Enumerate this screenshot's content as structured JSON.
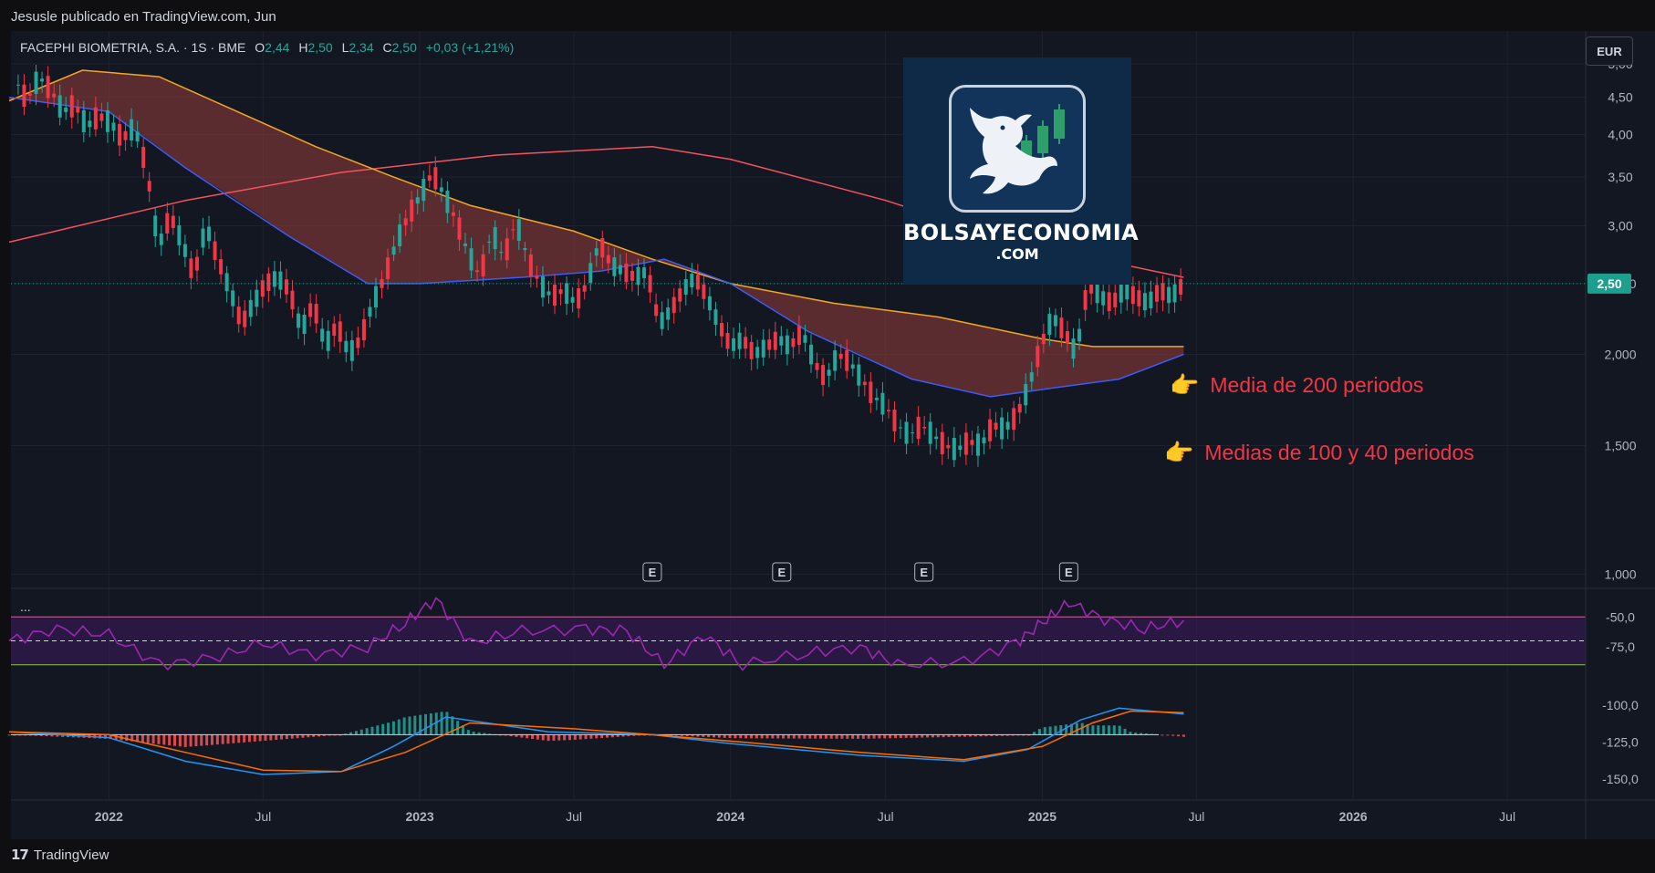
{
  "header": {
    "published": "Jesusle publicado en TradingView.com, Jun"
  },
  "footer": {
    "brand": "TradingView",
    "brand_icon": "tradingview-logo-icon"
  },
  "legend": {
    "symbol": "FACEPHI BIOMETRIA, S.A. · 1S · BME",
    "o_label": "O",
    "o": "2,44",
    "h_label": "H",
    "h": "2,50",
    "l_label": "L",
    "l": "2,34",
    "c_label": "C",
    "c": "2,50",
    "change": "+0,03 (+1,21%)"
  },
  "currency": "EUR",
  "logo": {
    "title": "BOLSAYECONOMIA",
    "subtitle": ".COM",
    "icon": "bull-candlestick-icon"
  },
  "annotations": {
    "ma200": "Media de 200 periodos",
    "ma100_40": "Medias de 100 y 40 periodos",
    "pointer_icon": "pointing-hand-icon"
  },
  "indicator_menu": "...",
  "earnings_marker": "E",
  "colors": {
    "up": "#26a69a",
    "down": "#f23645",
    "ma200": "#f7525f",
    "ma100": "#f5a623",
    "ma40": "#3d5cf5",
    "ribbon": "#8a3a3a",
    "rsi": "#9c27b0",
    "rsi_band": "#3a1a5c",
    "macd": "#2196f3",
    "signal": "#ff6d00",
    "price_badge": "#1e9e8c"
  },
  "chart_data": {
    "type": "candlestick",
    "title": "",
    "x_ticks": [
      "2022",
      "Jul",
      "2023",
      "Jul",
      "2024",
      "Jul",
      "2025",
      "Jul",
      "2026",
      "Jul"
    ],
    "x_tick_dates": [
      "2022-01-01",
      "2022-07-01",
      "2023-01-01",
      "2023-07-01",
      "2024-01-01",
      "2024-07-01",
      "2025-01-01",
      "2025-07-01",
      "2026-01-01",
      "2026-07-01"
    ],
    "y_ticks": [
      "5,00",
      "4,50",
      "4,00",
      "3,50",
      "3,00",
      "2,500",
      "2,000",
      "1,500",
      "1,000"
    ],
    "y_tick_values": [
      5.0,
      4.5,
      4.0,
      3.5,
      3.0,
      2.5,
      2.0,
      1.5,
      1.0
    ],
    "y_scale": "log",
    "ylim": [
      0.97,
      5.45
    ],
    "xlim": [
      "2021-09-08",
      "2026-10-01"
    ],
    "last_price": "2,50",
    "last_price_value": 2.5,
    "price_points": [
      [
        "2021-09-13",
        4.75
      ],
      [
        "2021-09-27",
        4.45
      ],
      [
        "2021-10-11",
        4.8
      ],
      [
        "2021-10-25",
        4.6
      ],
      [
        "2021-11-08",
        4.3
      ],
      [
        "2021-11-22",
        4.4
      ],
      [
        "2021-12-06",
        4.1
      ],
      [
        "2021-12-20",
        4.25
      ],
      [
        "2022-01-03",
        4.15
      ],
      [
        "2022-01-17",
        3.95
      ],
      [
        "2022-01-31",
        4.1
      ],
      [
        "2022-02-14",
        3.6
      ],
      [
        "2022-02-28",
        2.8
      ],
      [
        "2022-03-14",
        3.1
      ],
      [
        "2022-03-28",
        2.85
      ],
      [
        "2022-04-11",
        2.55
      ],
      [
        "2022-04-25",
        3.0
      ],
      [
        "2022-05-09",
        2.7
      ],
      [
        "2022-05-23",
        2.45
      ],
      [
        "2022-06-06",
        2.2
      ],
      [
        "2022-06-20",
        2.35
      ],
      [
        "2022-07-04",
        2.5
      ],
      [
        "2022-07-18",
        2.55
      ],
      [
        "2022-08-01",
        2.45
      ],
      [
        "2022-08-15",
        2.15
      ],
      [
        "2022-08-29",
        2.35
      ],
      [
        "2022-09-12",
        2.05
      ],
      [
        "2022-09-26",
        2.2
      ],
      [
        "2022-10-10",
        2.0
      ],
      [
        "2022-10-24",
        2.1
      ],
      [
        "2022-11-07",
        2.35
      ],
      [
        "2022-11-21",
        2.55
      ],
      [
        "2022-12-05",
        2.85
      ],
      [
        "2022-12-19",
        3.1
      ],
      [
        "2023-01-02",
        3.3
      ],
      [
        "2023-01-16",
        3.55
      ],
      [
        "2023-01-30",
        3.3
      ],
      [
        "2023-02-13",
        3.05
      ],
      [
        "2023-02-27",
        2.75
      ],
      [
        "2023-03-13",
        2.55
      ],
      [
        "2023-03-27",
        2.95
      ],
      [
        "2023-04-10",
        2.7
      ],
      [
        "2023-04-24",
        3.05
      ],
      [
        "2023-05-08",
        2.7
      ],
      [
        "2023-05-22",
        2.5
      ],
      [
        "2023-06-05",
        2.4
      ],
      [
        "2023-06-19",
        2.45
      ],
      [
        "2023-07-03",
        2.35
      ],
      [
        "2023-07-17",
        2.5
      ],
      [
        "2023-07-31",
        2.85
      ],
      [
        "2023-08-14",
        2.65
      ],
      [
        "2023-08-28",
        2.6
      ],
      [
        "2023-09-11",
        2.55
      ],
      [
        "2023-09-25",
        2.6
      ],
      [
        "2023-10-09",
        2.2
      ],
      [
        "2023-10-23",
        2.3
      ],
      [
        "2023-11-06",
        2.45
      ],
      [
        "2023-11-20",
        2.55
      ],
      [
        "2023-12-04",
        2.4
      ],
      [
        "2023-12-18",
        2.2
      ],
      [
        "2024-01-01",
        2.05
      ],
      [
        "2024-01-15",
        2.1
      ],
      [
        "2024-01-29",
        2.0
      ],
      [
        "2024-02-12",
        2.05
      ],
      [
        "2024-02-26",
        2.1
      ],
      [
        "2024-03-11",
        2.05
      ],
      [
        "2024-03-25",
        2.15
      ],
      [
        "2024-04-08",
        1.95
      ],
      [
        "2024-04-22",
        1.85
      ],
      [
        "2024-05-06",
        2.0
      ],
      [
        "2024-05-20",
        1.95
      ],
      [
        "2024-06-03",
        1.85
      ],
      [
        "2024-06-17",
        1.75
      ],
      [
        "2024-07-01",
        1.7
      ],
      [
        "2024-07-15",
        1.6
      ],
      [
        "2024-07-29",
        1.55
      ],
      [
        "2024-08-12",
        1.6
      ],
      [
        "2024-08-26",
        1.55
      ],
      [
        "2024-09-09",
        1.5
      ],
      [
        "2024-09-23",
        1.48
      ],
      [
        "2024-10-07",
        1.52
      ],
      [
        "2024-10-21",
        1.5
      ],
      [
        "2024-11-04",
        1.6
      ],
      [
        "2024-11-18",
        1.58
      ],
      [
        "2024-12-02",
        1.65
      ],
      [
        "2024-12-16",
        1.8
      ],
      [
        "2024-12-30",
        2.05
      ],
      [
        "2025-01-13",
        2.25
      ],
      [
        "2025-01-27",
        2.15
      ],
      [
        "2025-02-10",
        2.0
      ],
      [
        "2025-02-24",
        2.5
      ],
      [
        "2025-03-10",
        2.4
      ],
      [
        "2025-03-24",
        2.35
      ],
      [
        "2025-04-07",
        2.45
      ],
      [
        "2025-04-21",
        2.4
      ],
      [
        "2025-05-05",
        2.35
      ],
      [
        "2025-05-19",
        2.45
      ],
      [
        "2025-06-02",
        2.4
      ],
      [
        "2025-06-16",
        2.5
      ]
    ],
    "series": [
      {
        "kind": "ma200",
        "points": [
          [
            "2021-09-06",
            2.85
          ],
          [
            "2022-04-01",
            3.25
          ],
          [
            "2022-10-01",
            3.55
          ],
          [
            "2023-04-01",
            3.75
          ],
          [
            "2023-10-01",
            3.85
          ],
          [
            "2024-01-01",
            3.7
          ],
          [
            "2024-07-01",
            3.25
          ],
          [
            "2024-10-01",
            3.0
          ],
          [
            "2025-01-01",
            2.8
          ],
          [
            "2025-06-16",
            2.55
          ]
        ]
      },
      {
        "kind": "ma100",
        "points": [
          [
            "2021-09-06",
            4.45
          ],
          [
            "2021-12-01",
            4.9
          ],
          [
            "2022-03-01",
            4.8
          ],
          [
            "2022-06-01",
            4.3
          ],
          [
            "2022-09-01",
            3.85
          ],
          [
            "2022-12-01",
            3.5
          ],
          [
            "2023-03-01",
            3.2
          ],
          [
            "2023-07-01",
            2.95
          ],
          [
            "2023-10-01",
            2.7
          ],
          [
            "2024-01-01",
            2.5
          ],
          [
            "2024-05-01",
            2.35
          ],
          [
            "2024-09-01",
            2.25
          ],
          [
            "2025-01-01",
            2.1
          ],
          [
            "2025-03-01",
            2.05
          ],
          [
            "2025-06-16",
            2.05
          ]
        ]
      },
      {
        "kind": "ma40",
        "points": [
          [
            "2021-09-06",
            4.5
          ],
          [
            "2022-01-01",
            4.3
          ],
          [
            "2022-04-01",
            3.6
          ],
          [
            "2022-08-01",
            2.9
          ],
          [
            "2022-11-01",
            2.5
          ],
          [
            "2023-01-01",
            2.5
          ],
          [
            "2023-05-01",
            2.55
          ],
          [
            "2023-08-01",
            2.6
          ],
          [
            "2023-10-15",
            2.7
          ],
          [
            "2024-01-01",
            2.5
          ],
          [
            "2024-04-01",
            2.15
          ],
          [
            "2024-08-01",
            1.85
          ],
          [
            "2024-11-01",
            1.75
          ],
          [
            "2025-01-15",
            1.8
          ],
          [
            "2025-04-01",
            1.85
          ],
          [
            "2025-06-16",
            2.0
          ]
        ]
      }
    ],
    "earnings_dates": [
      "2023-10-01",
      "2024-03-01",
      "2024-08-15",
      "2025-02-01"
    ],
    "rsi": {
      "y_ticks": [
        "-50,0",
        "-75,0"
      ],
      "y_tick_values": [
        -50,
        -75
      ],
      "upper_band": -50,
      "lower_band": -90,
      "mid_line": -70,
      "points": [
        [
          "2021-09-06",
          -70
        ],
        [
          "2021-11-01",
          -60
        ],
        [
          "2022-01-01",
          -65
        ],
        [
          "2022-03-01",
          -90
        ],
        [
          "2022-05-01",
          -85
        ],
        [
          "2022-07-01",
          -72
        ],
        [
          "2022-09-01",
          -82
        ],
        [
          "2022-11-01",
          -75
        ],
        [
          "2022-12-15",
          -55
        ],
        [
          "2023-01-20",
          -35
        ],
        [
          "2023-03-01",
          -72
        ],
        [
          "2023-05-01",
          -62
        ],
        [
          "2023-07-15",
          -60
        ],
        [
          "2023-09-01",
          -62
        ],
        [
          "2023-10-15",
          -90
        ],
        [
          "2023-12-01",
          -65
        ],
        [
          "2024-01-15",
          -90
        ],
        [
          "2024-04-01",
          -80
        ],
        [
          "2024-06-01",
          -75
        ],
        [
          "2024-07-15",
          -90
        ],
        [
          "2024-10-01",
          -88
        ],
        [
          "2024-12-01",
          -72
        ],
        [
          "2025-01-01",
          -55
        ],
        [
          "2025-02-01",
          -38
        ],
        [
          "2025-03-15",
          -52
        ],
        [
          "2025-05-01",
          -60
        ],
        [
          "2025-06-16",
          -53
        ]
      ]
    },
    "macd": {
      "y_ticks": [
        "-100,0",
        "-125,0",
        "-150,0"
      ],
      "y_tick_values": [
        -100,
        -125,
        -150
      ],
      "zero_line": -120,
      "macd_points": [
        [
          "2021-09-06",
          -118
        ],
        [
          "2022-01-01",
          -122
        ],
        [
          "2022-04-01",
          -138
        ],
        [
          "2022-07-01",
          -147
        ],
        [
          "2022-10-01",
          -145
        ],
        [
          "2022-12-01",
          -128
        ],
        [
          "2023-02-01",
          -108
        ],
        [
          "2023-06-01",
          -118
        ],
        [
          "2023-10-01",
          -120
        ],
        [
          "2024-01-01",
          -126
        ],
        [
          "2024-06-01",
          -134
        ],
        [
          "2024-10-01",
          -138
        ],
        [
          "2024-12-15",
          -130
        ],
        [
          "2025-02-15",
          -110
        ],
        [
          "2025-04-01",
          -102
        ],
        [
          "2025-06-16",
          -106
        ]
      ],
      "signal_points": [
        [
          "2021-09-06",
          -118
        ],
        [
          "2022-01-01",
          -120
        ],
        [
          "2022-04-01",
          -132
        ],
        [
          "2022-07-01",
          -144
        ],
        [
          "2022-10-01",
          -145
        ],
        [
          "2022-12-15",
          -132
        ],
        [
          "2023-03-01",
          -112
        ],
        [
          "2023-07-01",
          -116
        ],
        [
          "2023-10-01",
          -120
        ],
        [
          "2024-01-15",
          -125
        ],
        [
          "2024-06-01",
          -132
        ],
        [
          "2024-10-01",
          -137
        ],
        [
          "2025-01-01",
          -128
        ],
        [
          "2025-03-01",
          -112
        ],
        [
          "2025-04-15",
          -104
        ],
        [
          "2025-06-16",
          -105
        ]
      ]
    }
  }
}
